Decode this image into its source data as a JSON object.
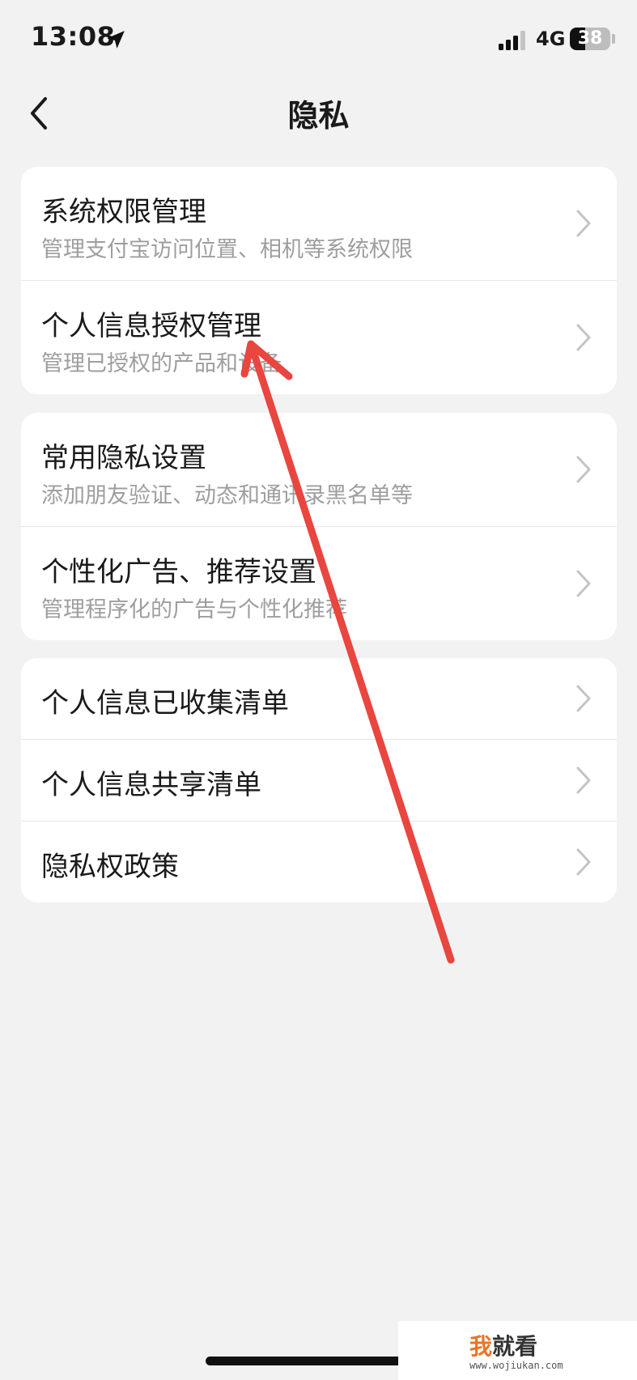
{
  "status_bar": {
    "time": "13:08",
    "network": "4G",
    "battery": "38",
    "battery_level_percent": 38,
    "location_icon": "location-arrow-icon",
    "signal_icon": "cellular-signal-icon"
  },
  "nav": {
    "back_icon": "chevron-left-icon",
    "title": "隐私"
  },
  "groups": [
    {
      "items": [
        {
          "title": "系统权限管理",
          "subtitle": "管理支付宝访问位置、相机等系统权限"
        },
        {
          "title": "个人信息授权管理",
          "subtitle": "管理已授权的产品和设备"
        }
      ]
    },
    {
      "items": [
        {
          "title": "常用隐私设置",
          "subtitle": "添加朋友验证、动态和通讯录黑名单等"
        },
        {
          "title": "个性化广告、推荐设置",
          "subtitle": "管理程序化的广告与个性化推荐"
        }
      ]
    },
    {
      "items": [
        {
          "title": "个人信息已收集清单"
        },
        {
          "title": "个人信息共享清单"
        },
        {
          "title": "隐私权政策"
        }
      ]
    }
  ],
  "colors": {
    "background": "#f2f2f2",
    "card": "#ffffff",
    "title_text": "#1a1a1a",
    "subtitle_text": "#9e9e9e",
    "chevron": "#c4c4c4",
    "annotation_arrow": "#e8463f"
  },
  "watermark": {
    "logo_accent": "我",
    "logo_rest": "就看",
    "url": "www.wojiukan.com"
  }
}
